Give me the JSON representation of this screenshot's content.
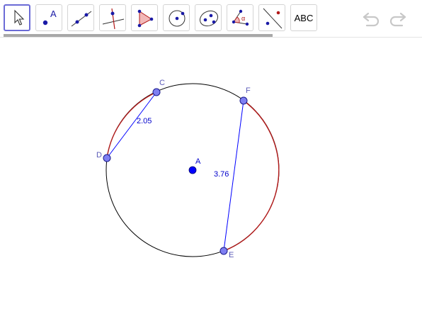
{
  "toolbar": {
    "tools": [
      {
        "name": "move-tool",
        "icon": "arrow-pointer-icon"
      },
      {
        "name": "point-tool",
        "icon": "point-icon",
        "label": "A"
      },
      {
        "name": "line-tool",
        "icon": "line-through-points-icon"
      },
      {
        "name": "perpendicular-line-tool",
        "icon": "perpendicular-line-icon"
      },
      {
        "name": "polygon-tool",
        "icon": "polygon-icon"
      },
      {
        "name": "circle-center-point-tool",
        "icon": "circle-with-center-icon"
      },
      {
        "name": "conic-tool",
        "icon": "ellipse-icon"
      },
      {
        "name": "angle-tool",
        "icon": "angle-icon",
        "label": "α"
      },
      {
        "name": "reflect-tool",
        "icon": "reflect-about-line-icon"
      },
      {
        "name": "text-tool",
        "icon": "text-icon",
        "label": "ABC"
      }
    ],
    "undo_icon": "undo-icon",
    "redo_icon": "redo-icon"
  },
  "colors": {
    "point_fill": "#7f7ff2",
    "point_outline": "#1a1a8c",
    "center_point": "#0000ff",
    "segment": "#0000ff",
    "arc_highlight": "#b21a1a",
    "circle": "#000000",
    "label": "#5a5ab8",
    "measure": "#0000cc",
    "tool_selected_border": "#6b6bd6"
  },
  "construction": {
    "points": [
      {
        "id": "A",
        "label": "A"
      },
      {
        "id": "C",
        "label": "C"
      },
      {
        "id": "D",
        "label": "D"
      },
      {
        "id": "E",
        "label": "E"
      },
      {
        "id": "F",
        "label": "F"
      }
    ],
    "segments": [
      {
        "from": "C",
        "to": "D",
        "length": "2.05"
      },
      {
        "from": "E",
        "to": "F",
        "length": "3.76"
      }
    ]
  }
}
